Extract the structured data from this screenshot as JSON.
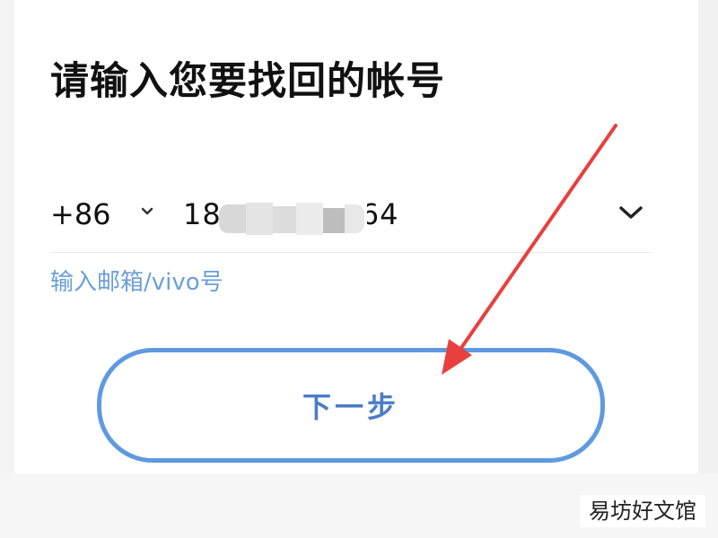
{
  "page": {
    "title": "请输入您要找回的帐号"
  },
  "phone_input": {
    "country_code": "+86",
    "number_prefix": "18",
    "number_suffix": "64"
  },
  "alt_login": {
    "label": "输入邮箱/vivo号"
  },
  "next_button": {
    "label": "下一步"
  },
  "icons": {
    "country_code_dropdown": "chevron-down-icon",
    "account_dropdown": "chevron-down-icon",
    "annotation": "red-arrow"
  },
  "colors": {
    "accent_blue": "#5f9ae0",
    "link_blue": "#6a9fd6",
    "arrow_red": "#e8403e"
  },
  "watermark": {
    "text": "易坊好文馆"
  }
}
